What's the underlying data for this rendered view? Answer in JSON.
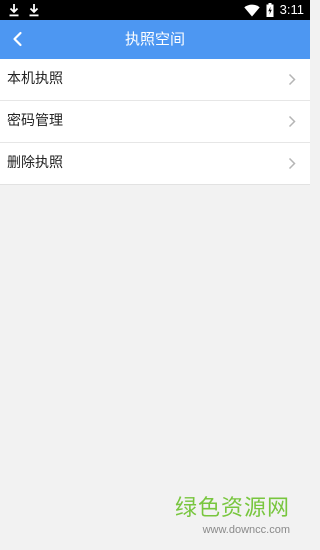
{
  "status_bar": {
    "time": "3:11",
    "left_icons": [
      "download-icon",
      "download-icon"
    ],
    "right_icons": [
      "wifi-icon",
      "battery-charging-icon"
    ]
  },
  "header": {
    "title": "执照空间",
    "back_icon": "chevron-left-icon",
    "background_color": "#4d97f2"
  },
  "menu": {
    "items": [
      {
        "label": "本机执照",
        "icon": "chevron-right-icon"
      },
      {
        "label": "密码管理",
        "icon": "chevron-right-icon"
      },
      {
        "label": "删除执照",
        "icon": "chevron-right-icon"
      }
    ]
  },
  "watermark": {
    "title": "绿色资源网",
    "url": "www.downcc.com",
    "color": "#78c63e"
  }
}
